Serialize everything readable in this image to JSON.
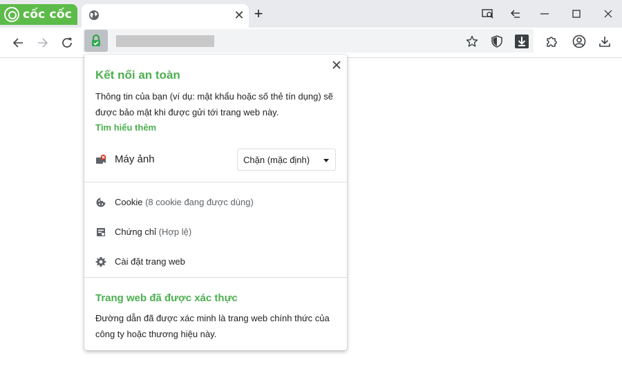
{
  "browser": {
    "brand_name": "cốc cốc",
    "brand_color": "#5dbb4a",
    "tab_title": "",
    "tab_close_glyph": "✕",
    "new_tab_glyph": "+"
  },
  "window_controls": [
    "screen-search-icon",
    "back-arrow-icon",
    "minimize-icon",
    "maximize-icon",
    "close-icon"
  ],
  "toolbar": {
    "icons": [
      "back-icon",
      "forward-icon",
      "reload-icon",
      "lock-icon",
      "star-icon",
      "shield-icon",
      "download-badge-icon",
      "extensions-icon",
      "profile-icon",
      "downloads-icon"
    ]
  },
  "popup": {
    "title": "Kết nối an toàn",
    "description": "Thông tin của bạn (ví dụ: mật khẩu hoặc số thẻ tín dụng) sẽ được bảo mật khi được gửi tới trang web này.",
    "learn_more": "Tìm hiểu thêm",
    "accent_color": "#4caf50",
    "permission": {
      "label": "Máy ảnh",
      "value": "Chặn (mặc định)"
    },
    "items": [
      {
        "label": "Cookie",
        "detail": " (8 cookie đang được dùng)",
        "icon": "cookie-icon"
      },
      {
        "label": "Chứng chỉ",
        "detail": " (Hợp lệ)",
        "icon": "certificate-icon"
      },
      {
        "label": "Cài đặt trang web",
        "detail": "",
        "icon": "gear-icon"
      }
    ],
    "verified_title": "Trang web đã được xác thực",
    "verified_description": "Đường dẫn đã được xác minh là trang web chính thức của công ty hoặc thương hiệu này."
  }
}
